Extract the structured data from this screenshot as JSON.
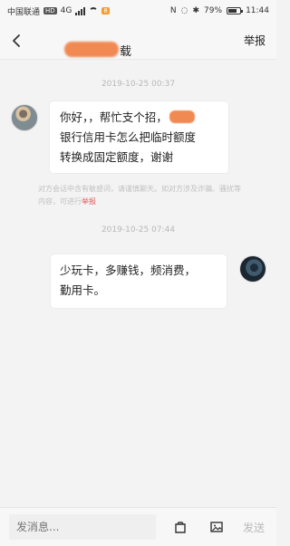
{
  "status": {
    "carrier": "中国联通",
    "network_badge": "HD",
    "network_gen": "4G",
    "notification_badge": "8",
    "battery": "79%",
    "battery_level": 0.79,
    "time": "11:44"
  },
  "nav": {
    "title_visible_suffix": "载",
    "report": "举报"
  },
  "chat": {
    "time1": "2019-10-25 00:37",
    "incoming_message_line1": "你好，，帮忙支个招，",
    "incoming_message_line2": "银行信用卡怎么把临时额度",
    "incoming_message_line3": "转换成固定额度，谢谢",
    "notice_prefix": "对方会话中含有敏感词，请谨慎聊天。如对方涉及诈骗、骚扰等内容，可进行",
    "notice_link": "举报",
    "time2": "2019-10-25 07:44",
    "outgoing_message_line1": "少玩卡，多赚钱，频消费，",
    "outgoing_message_line2": "勤用卡。"
  },
  "composer": {
    "placeholder": "发消息...",
    "send": "发送"
  },
  "icons": {
    "back": "back-arrow-icon",
    "bag": "bag-icon",
    "image": "image-icon"
  }
}
